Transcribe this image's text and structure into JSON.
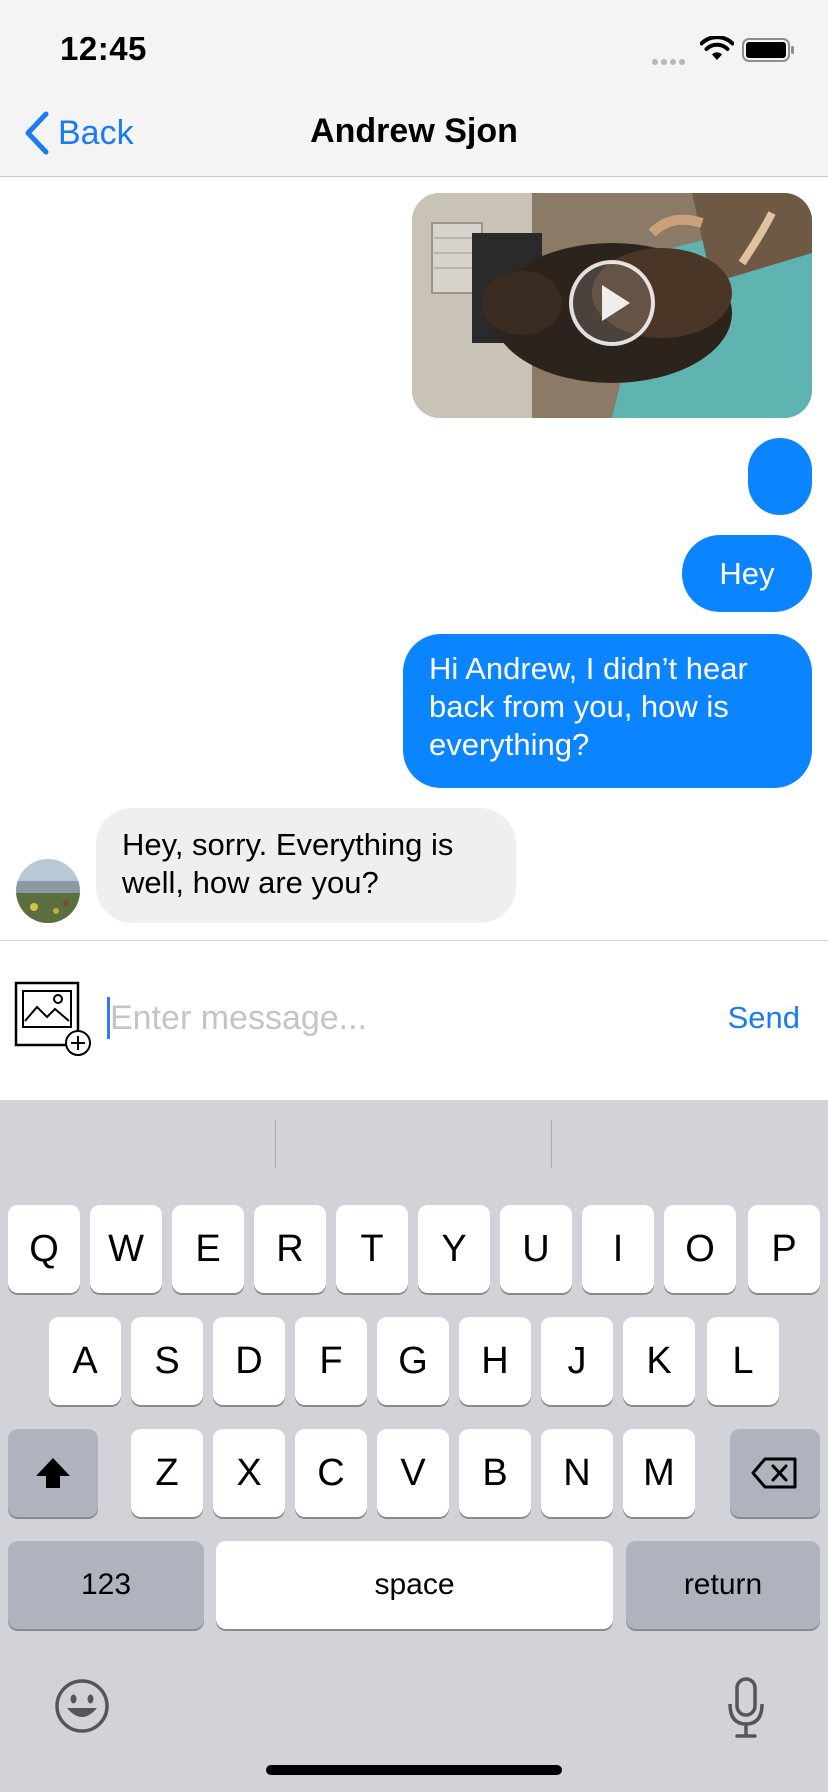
{
  "status_bar": {
    "time": "12:45"
  },
  "nav": {
    "back_label": "Back",
    "title": "Andrew Sjon"
  },
  "messages": {
    "outgoing": [
      {
        "text": "Hey"
      },
      {
        "text": "Hi Andrew, I didn’t hear back from you, how is everything?"
      }
    ],
    "incoming": [
      {
        "text": "Hey, sorry. Everything is well, how are you?"
      }
    ]
  },
  "composer": {
    "placeholder": "Enter message...",
    "send_label": "Send"
  },
  "keyboard": {
    "row1": [
      "Q",
      "W",
      "E",
      "R",
      "T",
      "Y",
      "U",
      "I",
      "O",
      "P"
    ],
    "row2": [
      "A",
      "S",
      "D",
      "F",
      "G",
      "H",
      "J",
      "K",
      "L"
    ],
    "row3": [
      "Z",
      "X",
      "C",
      "V",
      "B",
      "N",
      "M"
    ],
    "numbers_label": "123",
    "space_label": "space",
    "return_label": "return"
  },
  "colors": {
    "accent": "#0a84ff",
    "link": "#1a7cf0",
    "incoming_bubble": "#efefef",
    "keyboard_bg": "#d1d3d9"
  }
}
